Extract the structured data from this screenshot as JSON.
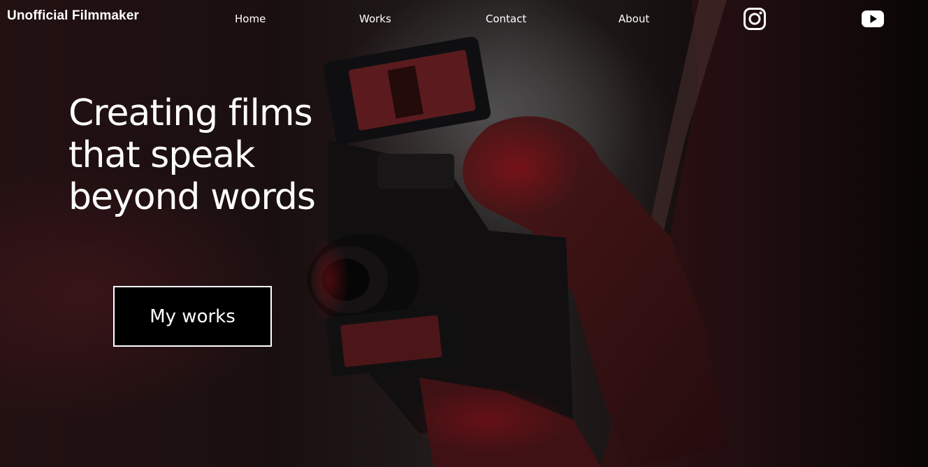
{
  "brand": "Unofficial Filmmaker",
  "nav": {
    "home": "Home",
    "works": "Works",
    "contact": "Contact",
    "about": "About"
  },
  "social": {
    "instagram_icon": "instagram-icon",
    "youtube_icon": "youtube-icon"
  },
  "hero": {
    "headline_line1": "Creating films",
    "headline_line2": "that speak",
    "headline_line3": "beyond words",
    "cta_label": "My works",
    "background_image": "filmmaker holding cinema camera rig"
  },
  "colors": {
    "text": "#ffffff",
    "cta_background": "#000000",
    "accent_red": "#b4121c"
  }
}
